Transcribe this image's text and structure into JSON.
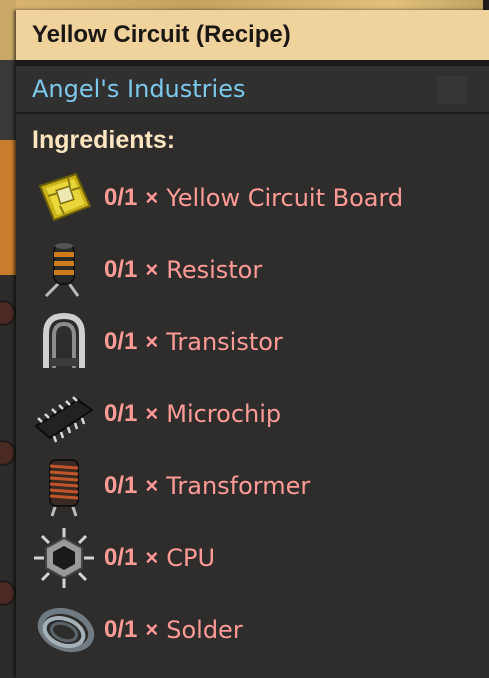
{
  "tooltip": {
    "title": "Yellow Circuit (Recipe)",
    "source": "Angel's Industries",
    "ingredients_heading": "Ingredients:",
    "times_symbol": "×",
    "ingredients": [
      {
        "amount": "0/1",
        "name": "Yellow Circuit Board",
        "icon": "yellow-circuit-board-icon"
      },
      {
        "amount": "0/1",
        "name": "Resistor",
        "icon": "resistor-icon"
      },
      {
        "amount": "0/1",
        "name": "Transistor",
        "icon": "transistor-icon"
      },
      {
        "amount": "0/1",
        "name": "Microchip",
        "icon": "microchip-icon"
      },
      {
        "amount": "0/1",
        "name": "Transformer",
        "icon": "transformer-icon"
      },
      {
        "amount": "0/1",
        "name": "CPU",
        "icon": "cpu-icon"
      },
      {
        "amount": "0/1",
        "name": "Solder",
        "icon": "solder-icon"
      }
    ]
  },
  "colors": {
    "title_bg": "#f0d39c",
    "source_text": "#7dc9ec",
    "heading_text": "#ffe6c0",
    "missing_text": "#ff9b96"
  }
}
